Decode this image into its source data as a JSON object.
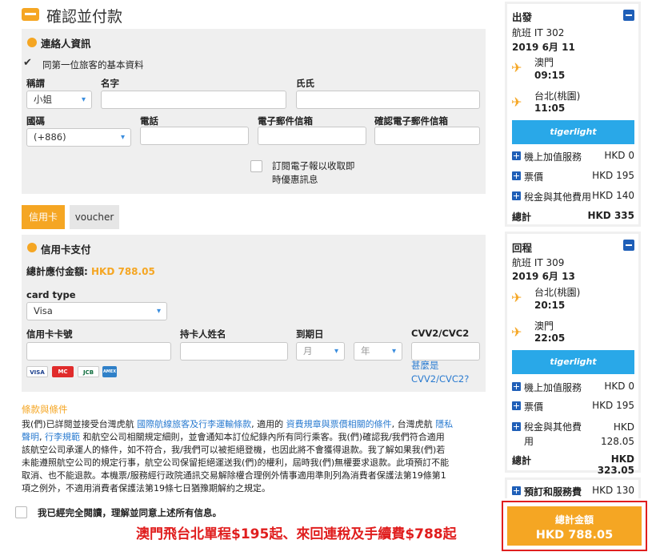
{
  "header": {
    "title": "確認並付款",
    "icon": "ticket-icon"
  },
  "contact": {
    "title": "連絡人資訊",
    "same_as_first": "同第一位旅客的基本資料",
    "labels": {
      "salutation": "稱謂",
      "first_name": "名字",
      "last_name": "氏氏",
      "country_code": "國碼",
      "phone": "電話",
      "email": "電子郵件信箱",
      "confirm_email": "確認電子郵件信箱"
    },
    "salutation_value": "小姐",
    "country_code_value": "(+886)",
    "newsletter_line1": "訂閱電子報以收取即",
    "newsletter_line2": "時優惠訊息"
  },
  "tabs": {
    "credit_card": "信用卡",
    "voucher": "voucher"
  },
  "payment": {
    "title": "信用卡支付",
    "total_label": "總計應付金額:",
    "total_amount": "HKD 788.05",
    "card_type_label": "card type",
    "card_type_value": "Visa",
    "labels": {
      "card_number": "信用卡卡號",
      "holder": "持卡人姓名",
      "expiry": "到期日",
      "cvv": "CVV2/CVC2"
    },
    "month_placeholder": "月",
    "year_placeholder": "年",
    "cvv_help_line1": "甚麼是",
    "cvv_help_line2": "CVV2/CVC2?",
    "card_logos": [
      "VISA",
      "MC",
      "JCB",
      "AMEX"
    ]
  },
  "terms": {
    "title": "條款與條件",
    "p1a": "我(們)已詳閱並接受台灣虎航 ",
    "link1": "國際航線旅客及行李運輸條款",
    "p1b": ", 適用的 ",
    "link2": "資費規章與票價相關的條件",
    "p1c": ", 台灣虎航 ",
    "link3": "隱私",
    "link3b": "聲明",
    "p1d": ", ",
    "link4": "行李規範",
    "p1e": " 和航空公司相關規定細則，並會通知本訂位紀錄內所有同行乘客。我(們)確認我/我們符合適用",
    "line3": "該航空公司承運人的條件，如不符合，我/我們可以被拒絕登機，也因此將不會獲得退款。我了解如果我(們)若",
    "line4": "未能遵照航空公司的規定行事，航空公司保留拒絕運送我(們)的權利，屆時我(們)無權要求退款。此項預訂不能",
    "line5": "取消、也不能退款。本機票/服務經行政院通訊交易解除權合理例外情事適用準則列為消費者保護法第19條第1",
    "line6": "項之例外，不適用消費者保護法第19條七日猶豫期解約之規定。",
    "agree": "我已經完全閱讀，理解並同意上述所有信息。"
  },
  "promo": "澳門飛台北單程$195起、來回連稅及手續費$788起",
  "outbound": {
    "title": "出發",
    "flight": "航班 IT 302",
    "date": "2019 6月 11",
    "from_city": "澳門",
    "from_time": "09:15",
    "to_city": "台北(桃園)",
    "to_time": "11:05",
    "brand": "tigerlight",
    "fees": [
      {
        "label": "機上加值服務",
        "value": "HKD 0"
      },
      {
        "label": "票價",
        "value": "HKD 195"
      },
      {
        "label": "稅金與其他費用",
        "value": "HKD 140"
      }
    ],
    "total_label": "總計",
    "total_value": "HKD 335"
  },
  "return": {
    "title": "回程",
    "flight": "航班 IT 309",
    "date": "2019 6月 13",
    "from_city": "台北(桃園)",
    "from_time": "20:15",
    "to_city": "澳門",
    "to_time": "22:05",
    "brand": "tigerlight",
    "fees": [
      {
        "label": "機上加值服務",
        "value": "HKD 0"
      },
      {
        "label": "票價",
        "value": "HKD 195"
      },
      {
        "label_line1": "稅金與其他費",
        "label_line2": "用",
        "value_line1": "HKD",
        "value_line2": "128.05"
      }
    ],
    "total_label": "總計",
    "total_value": "HKD 323.05"
  },
  "booking_fee": {
    "label": "預訂和服務費",
    "value": "HKD 130"
  },
  "grand_total": {
    "label": "總計金額",
    "value": "HKD 788.05"
  },
  "colors": {
    "accent": "#f5a623",
    "link": "#2a7bd0",
    "brand_blue": "#29a8e8",
    "alert_red": "#e01e1e"
  }
}
